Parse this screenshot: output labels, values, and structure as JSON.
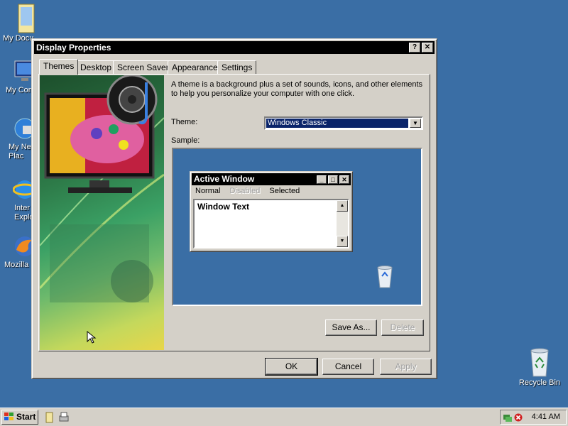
{
  "desktop": {
    "icons": [
      {
        "label": "My Documents",
        "visible_label": "My Docu",
        "icon": "folder-icon"
      },
      {
        "label": "My Computer",
        "visible_label": "My Com",
        "icon": "computer-icon"
      },
      {
        "label": "My Network Places",
        "visible_label": "My Ne\nPlac",
        "icon": "network-icon"
      },
      {
        "label": "Internet Explorer",
        "visible_label": "Inter\nExplo",
        "icon": "ie-icon"
      },
      {
        "label": "Mozilla Firefox",
        "visible_label": "Mozilla F",
        "icon": "firefox-icon"
      }
    ],
    "recycle_bin": "Recycle Bin"
  },
  "window": {
    "title": "Display Properties",
    "help_glyph": "?",
    "close_glyph": "✕",
    "tabs": [
      "Themes",
      "Desktop",
      "Screen Saver",
      "Appearance",
      "Settings"
    ],
    "active_tab": "Themes",
    "description": "A theme is a background plus a set of sounds, icons, and other elements to help you personalize your computer with one click.",
    "theme_label": "Theme:",
    "theme_value": "Windows Classic",
    "sample_label": "Sample:",
    "sample": {
      "window_title": "Active Window",
      "menu": [
        "Normal",
        "Disabled",
        "Selected"
      ],
      "window_text": "Window Text"
    },
    "buttons": {
      "save_as": "Save As...",
      "delete": "Delete",
      "ok": "OK",
      "cancel": "Cancel",
      "apply": "Apply"
    }
  },
  "taskbar": {
    "start": "Start",
    "clock": "4:41 AM"
  },
  "colors": {
    "desktop": "#3a6ea5",
    "face": "#d4d0c8",
    "selection": "#0a246a"
  }
}
